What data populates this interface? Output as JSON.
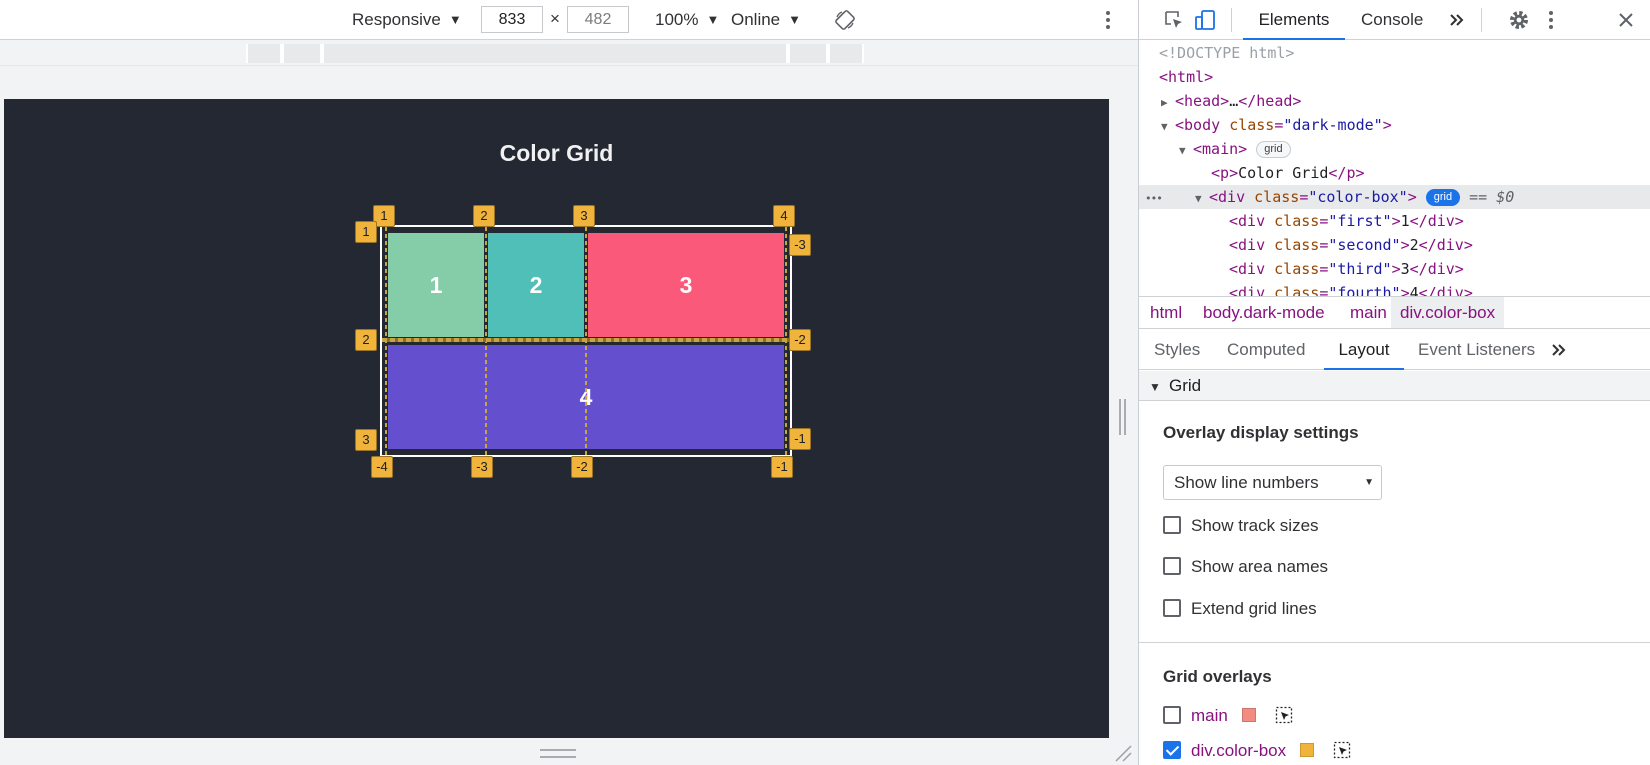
{
  "device_toolbar": {
    "device_select": "Responsive",
    "width_value": "833",
    "height_value": "482",
    "times_sign": "×",
    "zoom_select": "100%",
    "throttle_select": "Online",
    "rotate_icon": "rotate-icon",
    "more_icon": "more-vert-icon"
  },
  "viewport_page": {
    "heading": "Color Grid",
    "background": "#242833",
    "cells": [
      {
        "label": "1",
        "color": "#85cda8"
      },
      {
        "label": "2",
        "color": "#4fbfb7"
      },
      {
        "label": "3",
        "color": "#fb597a"
      },
      {
        "label": "4",
        "color": "#6450cf"
      }
    ],
    "grid_badges": {
      "columns_top": [
        "1",
        "2",
        "3",
        "4"
      ],
      "columns_bottom": [
        "-4",
        "-3",
        "-2",
        "-1"
      ],
      "rows_left": [
        "1",
        "2",
        "3"
      ],
      "rows_right": [
        "-3",
        "-2",
        "-1"
      ]
    }
  },
  "devtools": {
    "tabs": [
      "Elements",
      "Console"
    ],
    "active_tab": "Elements",
    "icons": [
      "inspect-element-icon",
      "device-toggle-icon",
      "more-tabs-icon",
      "settings-gear-icon",
      "more-vert-icon",
      "close-icon"
    ],
    "dom": {
      "doctype": "<!DOCTYPE html>",
      "html_open": "<html>",
      "head_tag": "head",
      "head_ellipsis": "…",
      "body_tag": "body",
      "body_attr_name": "class",
      "body_attr_value": "\"dark-mode\"",
      "main_tag": "main",
      "main_badge": "grid",
      "p_tag": "p",
      "p_text": "Color Grid",
      "div_tag": "div",
      "colorbox_attr_value": "\"color-box\"",
      "colorbox_badge": "grid",
      "dollar_ref": "== $0",
      "row_ellipsis": "•••",
      "children": [
        {
          "cls": "\"first\"",
          "text": "1"
        },
        {
          "cls": "\"second\"",
          "text": "2"
        },
        {
          "cls": "\"third\"",
          "text": "3"
        },
        {
          "cls": "\"fourth\"",
          "text": "4"
        }
      ]
    },
    "breadcrumbs": [
      "html",
      "body.dark-mode",
      "main",
      "div.color-box"
    ],
    "subtabs": [
      "Styles",
      "Computed",
      "Layout",
      "Event Listeners"
    ],
    "active_subtab": "Layout",
    "layout": {
      "section_title": "Grid",
      "overlay_settings_title": "Overlay display settings",
      "overlay_select_value": "Show line numbers",
      "checkboxes": [
        {
          "label": "Show track sizes",
          "checked": false
        },
        {
          "label": "Show area names",
          "checked": false
        },
        {
          "label": "Extend grid lines",
          "checked": false
        }
      ],
      "grid_overlays_title": "Grid overlays",
      "overlays": [
        {
          "name": "main",
          "checked": false,
          "color": "#f28b82"
        },
        {
          "name": "div.color-box",
          "checked": true,
          "color": "#f0b43c"
        }
      ]
    }
  }
}
